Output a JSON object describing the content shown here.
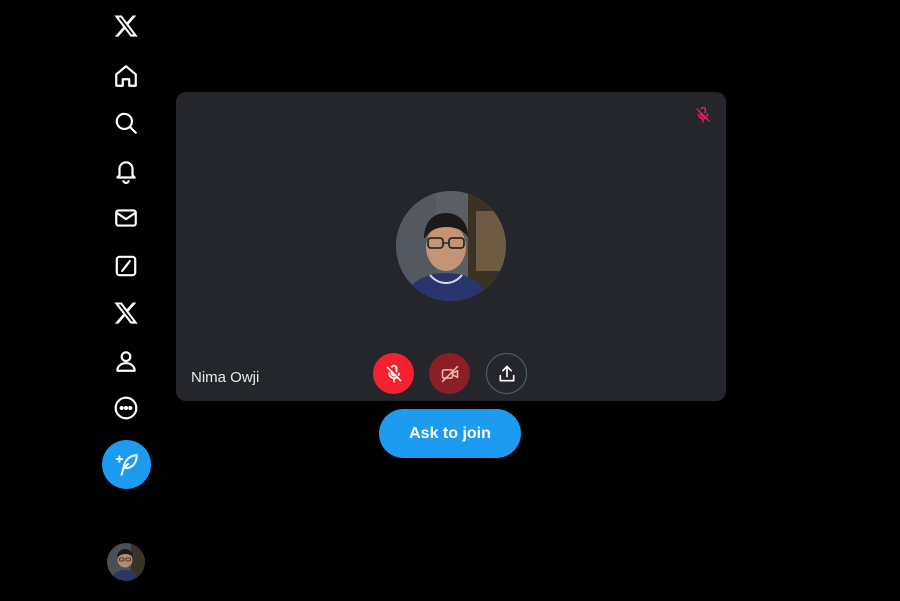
{
  "sidebar": {
    "items": [
      {
        "icon": "x-logo-icon"
      },
      {
        "icon": "home-icon"
      },
      {
        "icon": "search-icon"
      },
      {
        "icon": "bell-icon"
      },
      {
        "icon": "mail-icon"
      },
      {
        "icon": "grok-icon"
      },
      {
        "icon": "x-premium-icon"
      },
      {
        "icon": "profile-icon"
      },
      {
        "icon": "more-icon"
      }
    ],
    "post_button_icon": "feather-plus-icon",
    "account_avatar": "user-avatar"
  },
  "preview": {
    "participant_name": "Nima Owji",
    "status_icon": "mic-muted-icon",
    "controls": [
      {
        "name": "mic-off",
        "color": "#f4212e"
      },
      {
        "name": "camera-off",
        "color": "#8c1e26"
      },
      {
        "name": "share"
      }
    ]
  },
  "join_button": {
    "label": "Ask to join"
  },
  "colors": {
    "background": "#000000",
    "card": "#24262b",
    "accent": "#1d9bf0",
    "danger": "#f4212e"
  }
}
